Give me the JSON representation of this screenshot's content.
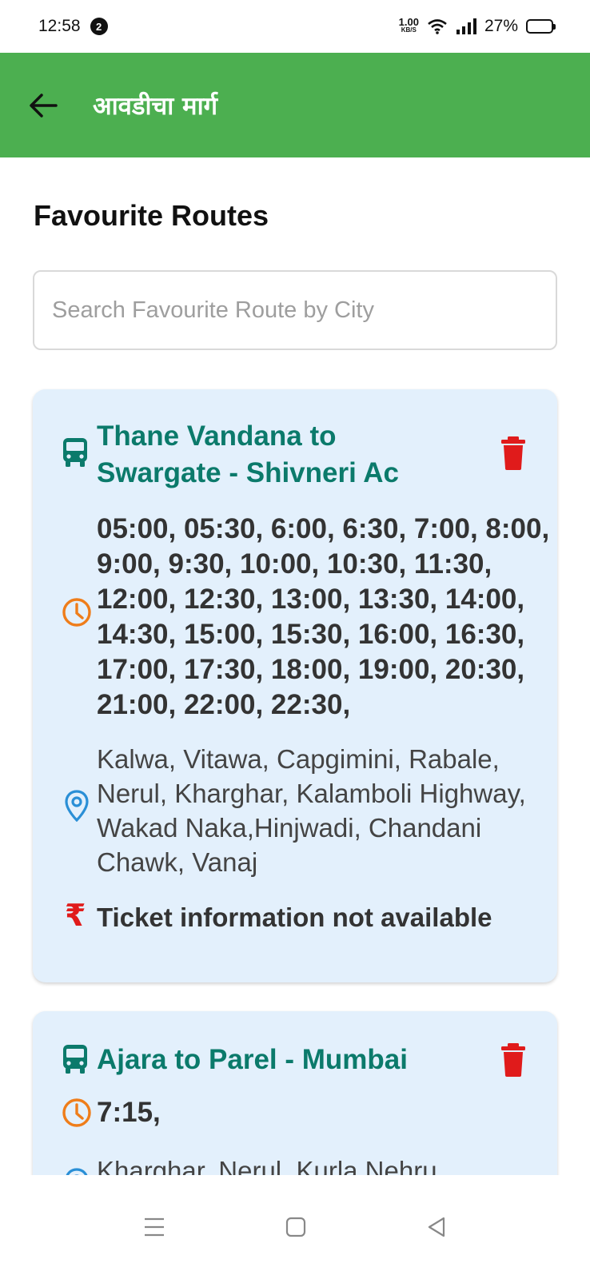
{
  "status_bar": {
    "time": "12:58",
    "notification_count": "2",
    "net_speed_value": "1.00",
    "net_speed_unit": "KB/S",
    "battery_percent": "27%"
  },
  "app_bar": {
    "title": "आवडीचा मार्ग",
    "back_icon": "arrow-left-icon",
    "color": "#4caf50"
  },
  "page": {
    "heading": "Favourite Routes"
  },
  "search": {
    "placeholder": "Search Favourite Route by City",
    "value": ""
  },
  "routes": [
    {
      "name": "Thane Vandana to Swargate - Shivneri Ac",
      "times": "05:00, 05:30, 6:00, 6:30, 7:00, 8:00, 9:00, 9:30, 10:00, 10:30, 11:30, 12:00, 12:30, 13:00, 13:30, 14:00, 14:30, 15:00, 15:30, 16:00, 16:30, 17:00, 17:30, 18:00, 19:00, 20:30, 21:00, 22:00, 22:30,",
      "stops": "Kalwa, Vitawa, Capgimini, Rabale, Nerul, Kharghar, Kalamboli Highway, Wakad Naka,Hinjwadi, Chandani Chawk, Vanaj",
      "ticket": "Ticket information not available",
      "rupee_symbol": "₹"
    },
    {
      "name": "Ajara to Parel - Mumbai",
      "times": "7:15,",
      "stops": "Kharghar, Nerul, Kurla Nehru"
    }
  ],
  "colors": {
    "route_name": "#0b7a6b",
    "card_bg": "#e3f0fc",
    "delete": "#e01b1b",
    "clock": "#ef7d1a",
    "location": "#2a8fd6"
  },
  "icons": [
    "bus-icon",
    "trash-icon",
    "clock-icon",
    "location-pin-icon",
    "rupee-icon",
    "menu-icon",
    "home-square-icon",
    "back-triangle-icon"
  ]
}
